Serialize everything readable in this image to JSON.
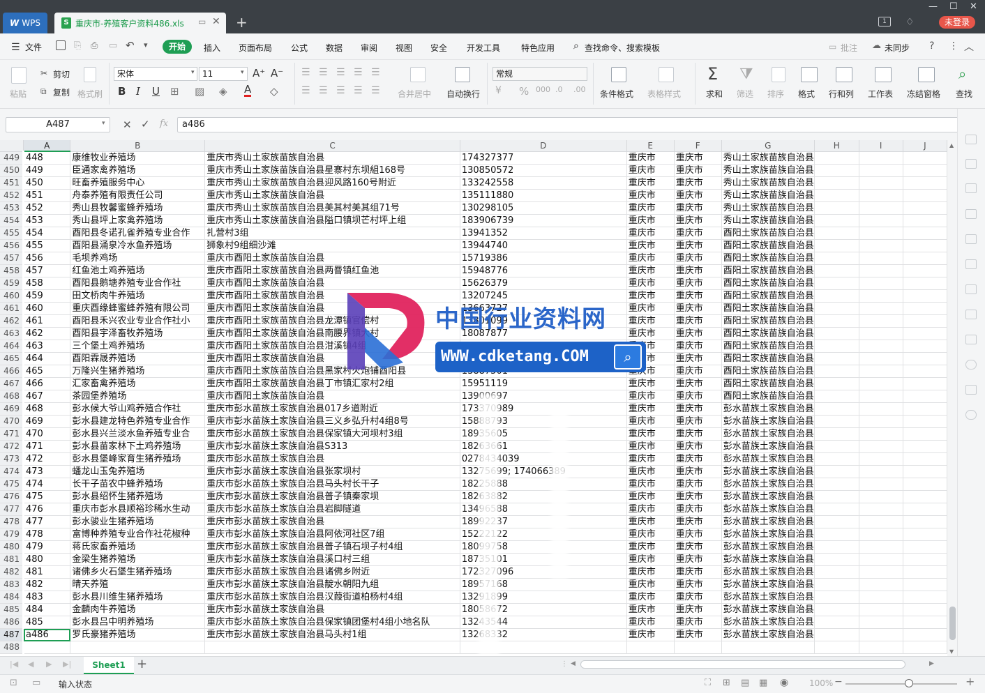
{
  "window": {
    "app_tab": "WPS",
    "doc_tab": "重庆市-养殖客户资料486.xls",
    "login": "未登录"
  },
  "menu": {
    "file": "文件",
    "items": [
      "开始",
      "插入",
      "页面布局",
      "公式",
      "数据",
      "审阅",
      "视图",
      "安全",
      "开发工具",
      "特色应用"
    ],
    "search": "查找命令、搜索模板",
    "annotate": "批注",
    "sync": "未同步"
  },
  "ribbon": {
    "paste": "粘贴",
    "cut": "剪切",
    "copy": "复制",
    "format_painter": "格式刷",
    "font_name": "宋体",
    "font_size": "11",
    "merge": "合并居中",
    "wrap": "自动换行",
    "number_format": "常规",
    "cond_format": "条件格式",
    "table_style": "表格样式",
    "sum": "求和",
    "filter": "筛选",
    "sort": "排序",
    "format": "格式",
    "rowcol": "行和列",
    "worksheet": "工作表",
    "freeze": "冻结窗格",
    "find": "查找"
  },
  "formula_bar": {
    "name_box": "A487",
    "formula": "a486"
  },
  "columns": [
    "A",
    "B",
    "C",
    "D",
    "E",
    "F",
    "G",
    "H",
    "I",
    "J"
  ],
  "rows": [
    {
      "n": "449",
      "a": "448",
      "b": "康维牧业养殖场",
      "c": "重庆市秀山土家族苗族自治县",
      "d": "174327377",
      "e": "重庆市",
      "f": "重庆市",
      "g": "秀山土家族苗族自治县"
    },
    {
      "n": "450",
      "a": "449",
      "b": "臣通家禽养殖场",
      "c": "重庆市秀山土家族苗族自治县星寨村东坝組168号",
      "d": "130850572",
      "e": "重庆市",
      "f": "重庆市",
      "g": "秀山土家族苗族自治县"
    },
    {
      "n": "451",
      "a": "450",
      "b": "旺畜养殖服务中心",
      "c": "重庆市秀山土家族苗族自治县迎风路160号附近",
      "d": "133242558",
      "e": "重庆市",
      "f": "重庆市",
      "g": "秀山土家族苗族自治县"
    },
    {
      "n": "452",
      "a": "451",
      "b": "舟泰养殖有限责任公司",
      "c": "重庆市秀山土家族苗族自治县",
      "d": "135111880",
      "e": "重庆市",
      "f": "重庆市",
      "g": "秀山土家族苗族自治县"
    },
    {
      "n": "453",
      "a": "452",
      "b": "秀山县牧馨蜜蜂养殖场",
      "c": "重庆市秀山土家族苗族自治县美其村美其组71号",
      "d": "130298105",
      "e": "重庆市",
      "f": "重庆市",
      "g": "秀山土家族苗族自治县"
    },
    {
      "n": "454",
      "a": "453",
      "b": "秀山县坪上家禽养殖场",
      "c": "重庆市秀山土家族苗族自治县隘口镇坝芒村坪上组",
      "d": "183906739",
      "e": "重庆市",
      "f": "重庆市",
      "g": "秀山土家族苗族自治县"
    },
    {
      "n": "455",
      "a": "454",
      "b": "酉阳县冬诺孔雀养殖专业合作",
      "c": "扎营村3组",
      "d": "13941352",
      "e": "重庆市",
      "f": "重庆市",
      "g": "酉阳土家族苗族自治县"
    },
    {
      "n": "456",
      "a": "455",
      "b": "酉阳县涌泉冷水鱼养殖场",
      "c": "狮象村9组细沙滩",
      "d": "13944740",
      "e": "重庆市",
      "f": "重庆市",
      "g": "酉阳土家族苗族自治县"
    },
    {
      "n": "457",
      "a": "456",
      "b": "毛坝养鸡场",
      "c": "重庆市酉阳土家族苗族自治县",
      "d": "15719386",
      "e": "重庆市",
      "f": "重庆市",
      "g": "酉阳土家族苗族自治县"
    },
    {
      "n": "458",
      "a": "457",
      "b": "红鱼池土鸡养殖场",
      "c": "重庆市酉阳土家族苗族自治县两罾镇红鱼池",
      "d": "15948776",
      "e": "重庆市",
      "f": "重庆市",
      "g": "酉阳土家族苗族自治县"
    },
    {
      "n": "459",
      "a": "458",
      "b": "酉阳县鹅塘养殖专业合作社",
      "c": "重庆市酉阳土家族苗族自治县",
      "d": "15626379",
      "e": "重庆市",
      "f": "重庆市",
      "g": "酉阳土家族苗族自治县"
    },
    {
      "n": "460",
      "a": "459",
      "b": "田文桥肉牛养殖场",
      "c": "重庆市酉阳土家族苗族自治县",
      "d": "13207245",
      "e": "重庆市",
      "f": "重庆市",
      "g": "酉阳土家族苗族自治县"
    },
    {
      "n": "461",
      "a": "460",
      "b": "重庆酉缘蜂蜜蜂养殖有限公司",
      "c": "重庆市酉阳土家族苗族自治县",
      "d": "13663727",
      "e": "重庆市",
      "f": "重庆市",
      "g": "酉阳土家族苗族自治县"
    },
    {
      "n": "462",
      "a": "461",
      "b": "酉阳县禾兴农业专业合作社小",
      "c": "重庆市酉阳土家族苗族自治县龙潭镇官偿村",
      "d": "13801099",
      "e": "重庆市",
      "f": "重庆市",
      "g": "酉阳土家族苗族自治县"
    },
    {
      "n": "463",
      "a": "462",
      "b": "酉阳县宇泽畜牧养殖场",
      "c": "重庆市酉阳土家族苗族自治县南腰界镇大村",
      "d": "18087877",
      "e": "重庆市",
      "f": "重庆市",
      "g": "酉阳土家族苗族自治县"
    },
    {
      "n": "464",
      "a": "463",
      "b": "三个堡土鸡养殖场",
      "c": "重庆市酉阳土家族苗族自治县泔溪镇4组",
      "d": "18386317",
      "e": "重庆市",
      "f": "重庆市",
      "g": "酉阳土家族苗族自治县"
    },
    {
      "n": "465",
      "a": "464",
      "b": "酉阳霖晟养殖场",
      "c": "重庆市酉阳土家族苗族自治县",
      "d": "13880031",
      "e": "重庆市",
      "f": "重庆市",
      "g": "酉阳土家族苗族自治县"
    },
    {
      "n": "466",
      "a": "465",
      "b": "万隆兴生猪养殖场",
      "c": "重庆市酉阳土家族苗族自治县黑家村火炮铺酉阳县",
      "d": "13887501",
      "e": "重庆市",
      "f": "重庆市",
      "g": "酉阳土家族苗族自治县"
    },
    {
      "n": "467",
      "a": "466",
      "b": "汇家畜禽养殖场",
      "c": "重庆市酉阳土家族苗族自治县丁市镇汇家村2组",
      "d": "15951119",
      "e": "重庆市",
      "f": "重庆市",
      "g": "酉阳土家族苗族自治县"
    },
    {
      "n": "468",
      "a": "467",
      "b": "茶园堡养殖场",
      "c": "重庆市酉阳土家族苗族自治县",
      "d": "13900697",
      "e": "重庆市",
      "f": "重庆市",
      "g": "酉阳土家族苗族自治县"
    },
    {
      "n": "469",
      "a": "468",
      "b": "彭水候大爷山鸡养殖合作社",
      "c": "重庆市彭水苗族土家族自治县017乡道附近",
      "d": "173370989",
      "e": "重庆市",
      "f": "重庆市",
      "g": "彭水苗族土家族自治县"
    },
    {
      "n": "470",
      "a": "469",
      "b": "彭水县建龙特色养殖专业合作",
      "c": "重庆市彭水苗族土家族自治县三义乡弘升村4组8号",
      "d": "15888793",
      "e": "重庆市",
      "f": "重庆市",
      "g": "彭水苗族土家族自治县"
    },
    {
      "n": "471",
      "a": "470",
      "b": "彭水县兴兰淡水鱼养殖专业合",
      "c": "重庆市彭水苗族土家族自治县保家镇大河坝村3组",
      "d": "18935605",
      "e": "重庆市",
      "f": "重庆市",
      "g": "彭水苗族土家族自治县"
    },
    {
      "n": "472",
      "a": "471",
      "b": "彭水县苗家林下土鸡养殖场",
      "c": "重庆市彭水苗族土家族自治县S313",
      "d": "18263661",
      "e": "重庆市",
      "f": "重庆市",
      "g": "彭水苗族土家族自治县"
    },
    {
      "n": "473",
      "a": "472",
      "b": "彭水县堡峰家育生猪养殖场",
      "c": "重庆市彭水苗族土家族自治县",
      "d": "0278434039",
      "e": "重庆市",
      "f": "重庆市",
      "g": "彭水苗族土家族自治县"
    },
    {
      "n": "474",
      "a": "473",
      "b": "蟠龙山玉兔养殖场",
      "c": "重庆市彭水苗族土家族自治县张家坝村",
      "d": "13275699; 174066389",
      "e": "重庆市",
      "f": "重庆市",
      "g": "彭水苗族土家族自治县"
    },
    {
      "n": "475",
      "a": "474",
      "b": "长干子苗农中蜂养殖场",
      "c": "重庆市彭水苗族土家族自治县马头村长干子",
      "d": "18225888",
      "e": "重庆市",
      "f": "重庆市",
      "g": "彭水苗族土家族自治县"
    },
    {
      "n": "476",
      "a": "475",
      "b": "彭水县绍怀生猪养殖场",
      "c": "重庆市彭水苗族土家族自治县普子镇秦家坝",
      "d": "18263882",
      "e": "重庆市",
      "f": "重庆市",
      "g": "彭水苗族土家族自治县"
    },
    {
      "n": "477",
      "a": "476",
      "b": "重庆市彭水县顺裕珍稀水生动",
      "c": "重庆市彭水苗族土家族自治县岩脚隧道",
      "d": "13496588",
      "e": "重庆市",
      "f": "重庆市",
      "g": "彭水苗族土家族自治县"
    },
    {
      "n": "478",
      "a": "477",
      "b": "彭水骏业生猪养殖场",
      "c": "重庆市彭水苗族土家族自治县",
      "d": "18992237",
      "e": "重庆市",
      "f": "重庆市",
      "g": "彭水苗族土家族自治县"
    },
    {
      "n": "479",
      "a": "478",
      "b": "富博种养殖专业合作社花椒种",
      "c": "重庆市彭水苗族土家族自治县阿依河社区7组",
      "d": "15222122",
      "e": "重庆市",
      "f": "重庆市",
      "g": "彭水苗族土家族自治县"
    },
    {
      "n": "480",
      "a": "479",
      "b": "蒋氏家畜养殖场",
      "c": "重庆市彭水苗族土家族自治县普子镇石坝子村4组",
      "d": "18099758",
      "e": "重庆市",
      "f": "重庆市",
      "g": "彭水苗族土家族自治县"
    },
    {
      "n": "481",
      "a": "480",
      "b": "金梁生猪养殖场",
      "c": "重庆市彭水苗族土家族自治县溪口村三组",
      "d": "18735101",
      "e": "重庆市",
      "f": "重庆市",
      "g": "彭水苗族土家族自治县"
    },
    {
      "n": "482",
      "a": "481",
      "b": "诸佛乡火石堡生猪养殖场",
      "c": "重庆市彭水苗族土家族自治县诸佛乡附近",
      "d": "172327096",
      "e": "重庆市",
      "f": "重庆市",
      "g": "彭水苗族土家族自治县"
    },
    {
      "n": "483",
      "a": "482",
      "b": "晴天养殖",
      "c": "重庆市彭水苗族土家族自治县靛水朝阳九组",
      "d": "18957168",
      "e": "重庆市",
      "f": "重庆市",
      "g": "彭水苗族土家族自治县"
    },
    {
      "n": "484",
      "a": "483",
      "b": "彭水县川维生猪养殖场",
      "c": "重庆市彭水苗族土家族自治县汉葭街道柏杨村4组",
      "d": "13291899",
      "e": "重庆市",
      "f": "重庆市",
      "g": "彭水苗族土家族自治县"
    },
    {
      "n": "485",
      "a": "484",
      "b": "金麟肉牛养殖场",
      "c": "重庆市彭水苗族土家族自治县",
      "d": "18058672",
      "e": "重庆市",
      "f": "重庆市",
      "g": "彭水苗族土家族自治县"
    },
    {
      "n": "486",
      "a": "485",
      "b": "彭水县吕中明养殖场",
      "c": "重庆市彭水苗族土家族自治县保家镇团堡村4组小地名队",
      "d": "13243544",
      "e": "重庆市",
      "f": "重庆市",
      "g": "彭水苗族土家族自治县"
    },
    {
      "n": "487",
      "a": "a486",
      "b": "罗氏豪猪养殖场",
      "c": "重庆市彭水苗族土家族自治县马头村1组",
      "d": "13268332",
      "e": "重庆市",
      "f": "重庆市",
      "g": "彭水苗族土家族自治县"
    },
    {
      "n": "488",
      "a": "",
      "b": "",
      "c": "",
      "d": "",
      "e": "",
      "f": "",
      "g": ""
    }
  ],
  "sheet_tab": "Sheet1",
  "status": {
    "mode": "输入状态",
    "zoom": "100%"
  },
  "watermark": {
    "title": "中国行业资料网",
    "url": "WWW.cdketang.COM"
  },
  "colors": {
    "accent": "#1e9e54",
    "titlebar": "#3b4045",
    "wps_blue": "#2d6fbd",
    "login_red": "#e8564a"
  }
}
